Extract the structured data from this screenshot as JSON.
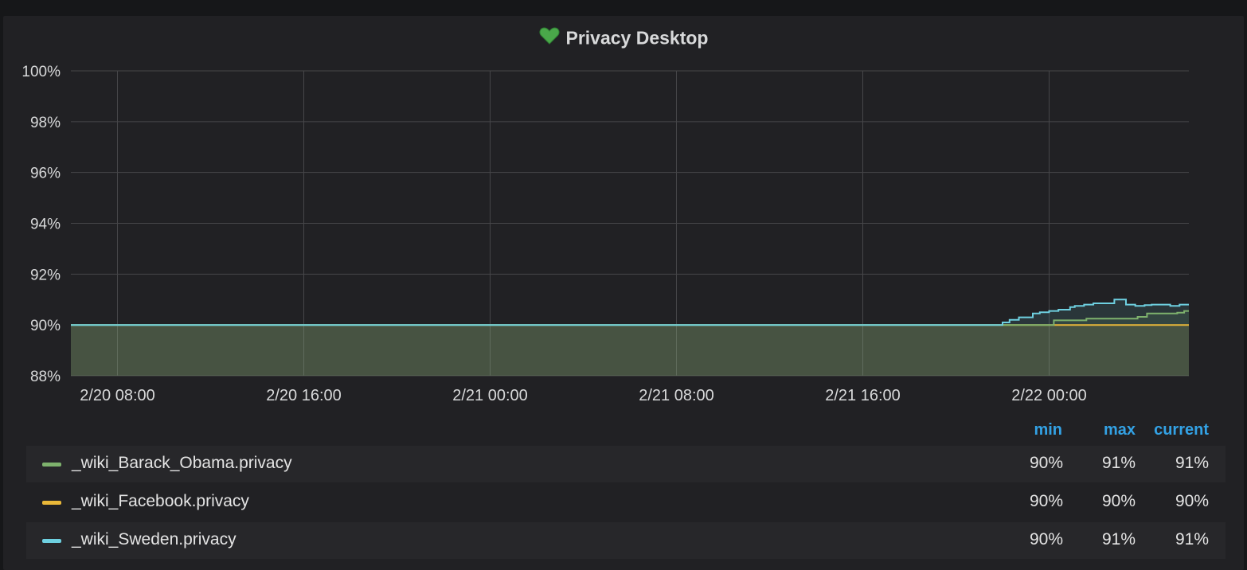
{
  "panel": {
    "title": "Privacy Desktop",
    "title_icon": "heart-icon",
    "title_icon_color": "#4aa84a"
  },
  "legend": {
    "headers": {
      "min": "min",
      "max": "max",
      "current": "current"
    },
    "rows": [
      {
        "name": "_wiki_Barack_Obama.privacy",
        "color": "#7eb26d",
        "min": "90%",
        "max": "91%",
        "current": "91%"
      },
      {
        "name": "_wiki_Facebook.privacy",
        "color": "#eab839",
        "min": "90%",
        "max": "90%",
        "current": "90%"
      },
      {
        "name": "_wiki_Sweden.privacy",
        "color": "#6ed0e0",
        "min": "90%",
        "max": "91%",
        "current": "91%"
      }
    ]
  },
  "chart_data": {
    "type": "line",
    "x_range": [
      "2/20 06:00",
      "2/22 06:00"
    ],
    "ylim": [
      88,
      100
    ],
    "y_ticks": [
      "88%",
      "90%",
      "92%",
      "94%",
      "96%",
      "98%",
      "100%"
    ],
    "x_ticks": [
      "2/20 08:00",
      "2/20 16:00",
      "2/21 00:00",
      "2/21 08:00",
      "2/21 16:00",
      "2/22 00:00"
    ],
    "x_tick_hours": [
      2,
      10,
      18,
      26,
      34,
      42
    ],
    "grid": true,
    "fill_below_from": 88,
    "series": [
      {
        "name": "_wiki_Barack_Obama.privacy",
        "color": "#7eb26d",
        "hours": [
          0,
          42.2,
          42.2,
          43.6,
          43.6,
          45.8,
          45.8,
          46.2,
          46.2,
          47.5,
          47.5,
          47.8,
          47.8,
          48.0
        ],
        "values": [
          90,
          90,
          90.18,
          90.18,
          90.25,
          90.25,
          90.32,
          90.32,
          90.45,
          90.45,
          90.48,
          90.48,
          90.55,
          90.55
        ]
      },
      {
        "name": "_wiki_Facebook.privacy",
        "color": "#eab839",
        "hours": [
          0,
          48
        ],
        "values": [
          90,
          90
        ]
      },
      {
        "name": "_wiki_Sweden.privacy",
        "color": "#6ed0e0",
        "hours": [
          0,
          40,
          40,
          40.3,
          40.3,
          40.7,
          40.7,
          41.3,
          41.3,
          41.6,
          41.6,
          42.0,
          42.0,
          42.4,
          42.4,
          42.9,
          42.9,
          43.1,
          43.1,
          43.5,
          43.5,
          43.9,
          43.9,
          44.0,
          44.0,
          44.3,
          44.3,
          44.8,
          44.8,
          45.3,
          45.3,
          45.7,
          45.7,
          46.1,
          46.1,
          46.4,
          46.4,
          47.2,
          47.2,
          47.6,
          47.6,
          48.0
        ],
        "values": [
          90,
          90,
          90.1,
          90.1,
          90.2,
          90.2,
          90.3,
          90.3,
          90.45,
          90.45,
          90.5,
          90.5,
          90.55,
          90.55,
          90.6,
          90.6,
          90.7,
          90.7,
          90.75,
          90.75,
          90.8,
          90.8,
          90.85,
          90.85,
          90.85,
          90.85,
          90.85,
          90.85,
          91.0,
          91.0,
          90.8,
          90.8,
          90.75,
          90.75,
          90.78,
          90.78,
          90.8,
          90.8,
          90.75,
          90.75,
          90.8,
          90.8
        ]
      }
    ]
  }
}
